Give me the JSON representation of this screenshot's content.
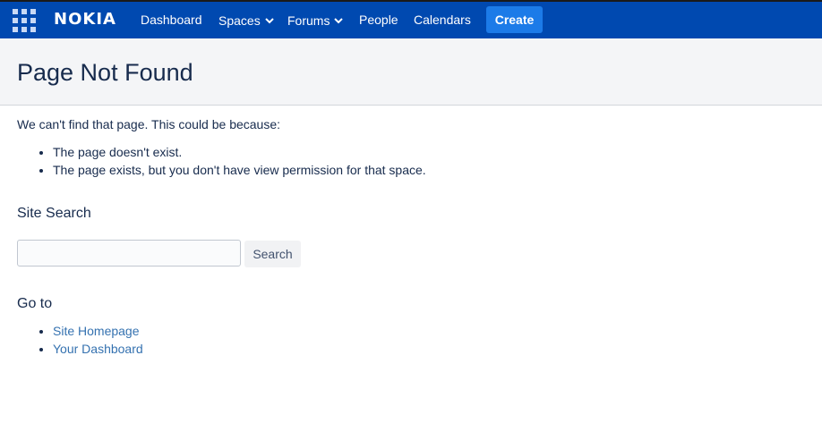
{
  "nav": {
    "logo": "NOKIA",
    "items": [
      {
        "label": "Dashboard",
        "dropdown": false
      },
      {
        "label": "Spaces",
        "dropdown": true
      },
      {
        "label": "Forums",
        "dropdown": true
      },
      {
        "label": "People",
        "dropdown": false
      },
      {
        "label": "Calendars",
        "dropdown": false
      }
    ],
    "create_label": "Create"
  },
  "page": {
    "title": "Page Not Found",
    "intro": "We can't find that page. This could be because:",
    "reasons": [
      "The page doesn't exist.",
      "The page exists, but you don't have view permission for that space."
    ]
  },
  "search": {
    "heading": "Site Search",
    "input_value": "",
    "button_label": "Search"
  },
  "goto": {
    "heading": "Go to",
    "links": [
      "Site Homepage",
      "Your Dashboard"
    ]
  },
  "colors": {
    "nav_bg": "#0049b0",
    "create_button": "#1c7be8",
    "link": "#3572b0"
  }
}
